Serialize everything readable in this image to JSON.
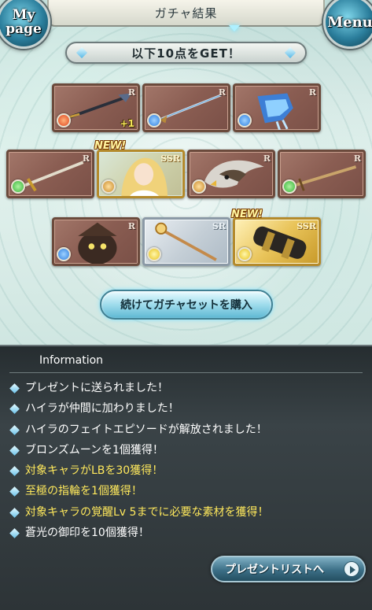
{
  "header": {
    "title": "ガチャ結果",
    "mypage_label": "My page",
    "menu_label": "Menu"
  },
  "banner": {
    "text": "以下10点をGET！"
  },
  "cards": [
    {
      "name": "spear",
      "rarity": "R",
      "element": "fire",
      "element_color": "#e0451f",
      "bonus": "+1",
      "is_new": false
    },
    {
      "name": "lance",
      "rarity": "R",
      "element": "water",
      "element_color": "#2f7fe0",
      "bonus": "",
      "is_new": false
    },
    {
      "name": "gauntlet",
      "rarity": "R",
      "element": "water",
      "element_color": "#2f7fe0",
      "bonus": "",
      "is_new": false
    },
    {
      "name": "sword",
      "rarity": "R",
      "element": "wind",
      "element_color": "#37b53a",
      "bonus": "",
      "is_new": false
    },
    {
      "name": "character",
      "rarity": "SSR",
      "element": "earth",
      "element_color": "#c98a2a",
      "bonus": "",
      "is_new": true
    },
    {
      "name": "eagle",
      "rarity": "R",
      "element": "earth",
      "element_color": "#c98a2a",
      "bonus": "",
      "is_new": false
    },
    {
      "name": "blade",
      "rarity": "R",
      "element": "wind",
      "element_color": "#37b53a",
      "bonus": "",
      "is_new": false
    },
    {
      "name": "summon",
      "rarity": "R",
      "element": "water",
      "element_color": "#2f7fe0",
      "bonus": "",
      "is_new": false
    },
    {
      "name": "staff",
      "rarity": "SR",
      "element": "light",
      "element_color": "#e8c21a",
      "bonus": "",
      "is_new": false
    },
    {
      "name": "cannon",
      "rarity": "SSR",
      "element": "light",
      "element_color": "#e8c21a",
      "bonus": "",
      "is_new": true
    }
  ],
  "new_label": "NEW!",
  "gacha_button": {
    "label": "続けてガチャセットを購入"
  },
  "information": {
    "title": "Information",
    "items": [
      {
        "text": "プレゼントに送られました！",
        "highlight": false
      },
      {
        "text": "ハイラが仲間に加わりました！",
        "highlight": false
      },
      {
        "text": "ハイラのフェイトエピソードが解放されました！",
        "highlight": false
      },
      {
        "text": "ブロンズムーンを1個獲得！",
        "highlight": false
      },
      {
        "text": "対象キャラがLBを30獲得！",
        "highlight": true
      },
      {
        "text": "至極の指輪を1個獲得！",
        "highlight": true
      },
      {
        "text": "対象キャラの覚醒Lv 5までに必要な素材を獲得！",
        "highlight": true
      },
      {
        "text": "蒼光の御印を10個獲得！",
        "highlight": false
      }
    ]
  },
  "present_button": {
    "label": "プレゼントリストへ"
  }
}
